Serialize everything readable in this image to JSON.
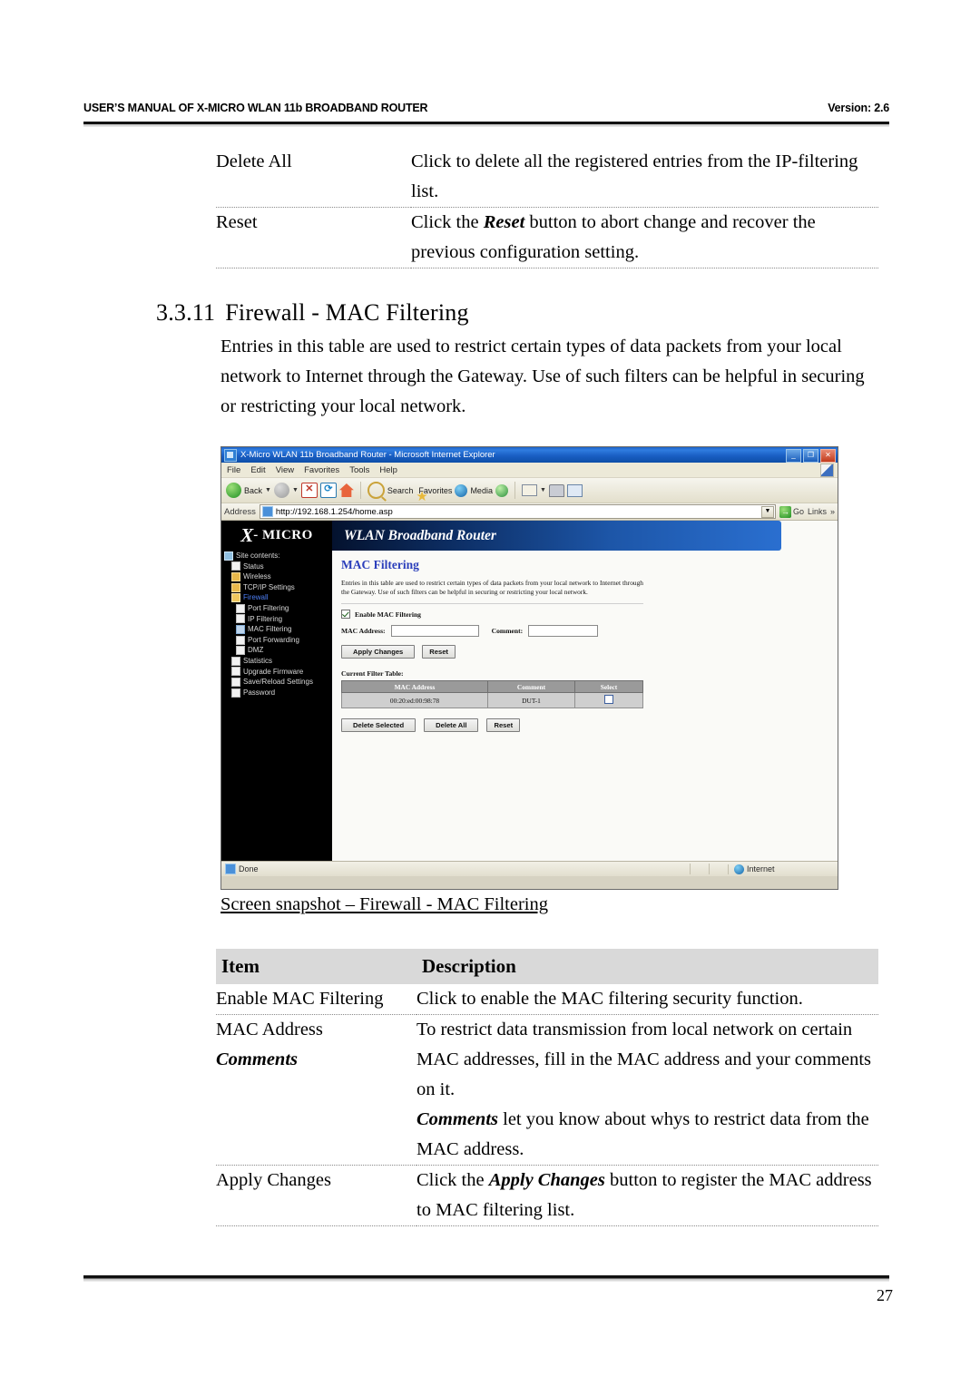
{
  "doc": {
    "header_left": "USER’S MANUAL OF X-MICRO WLAN 11b BROADBAND ROUTER",
    "header_right": "Version: 2.6",
    "page_number": "27"
  },
  "top_table": {
    "rows": [
      {
        "item": "Delete All",
        "desc": "Click to delete all the registered entries from the IP-filtering list."
      },
      {
        "item": "Reset",
        "desc_pre": "Click the ",
        "desc_em": "Reset",
        "desc_post": " button to abort change and recover the previous configuration setting."
      }
    ]
  },
  "section": {
    "number": "3.3.11",
    "title": "Firewall - MAC Filtering",
    "body": "Entries in this table are used to restrict certain types of data packets from your local network to Internet through the Gateway. Use of such filters can be helpful in securing or restricting your local network."
  },
  "browser": {
    "window_title": "X-Micro WLAN 11b Broadband Router - Microsoft Internet Explorer",
    "window_buttons": {
      "minimize": "_",
      "restore": "❐",
      "close": "✕"
    },
    "menus": [
      "File",
      "Edit",
      "View",
      "Favorites",
      "Tools",
      "Help"
    ],
    "toolbar": {
      "back": "Back",
      "search": "Search",
      "favorites": "Favorites",
      "media": "Media"
    },
    "address": {
      "label": "Address",
      "url": "http://192.168.1.254/home.asp",
      "go": "Go",
      "links": "Links"
    },
    "status": {
      "left": "Done",
      "right": "Internet"
    }
  },
  "router": {
    "logo": {
      "x": "X",
      "micro": "- MICRO"
    },
    "banner": "WLAN Broadband Router",
    "tree": [
      {
        "label": "Site contents:",
        "icon": "book-icon",
        "level": 1
      },
      {
        "label": "Status",
        "icon": "page-icon",
        "level": 1
      },
      {
        "label": "Wireless",
        "icon": "folder-icon",
        "level": 1
      },
      {
        "label": "TCP/IP Settings",
        "icon": "folder-icon",
        "level": 1
      },
      {
        "label": "Firewall",
        "icon": "folder-open-icon",
        "level": 1,
        "selected": true
      },
      {
        "label": "Port Filtering",
        "icon": "page-icon",
        "level": 2
      },
      {
        "label": "IP Filtering",
        "icon": "page-icon",
        "level": 2
      },
      {
        "label": "MAC Filtering",
        "icon": "page-selected-icon",
        "level": 2
      },
      {
        "label": "Port Forwarding",
        "icon": "page-icon",
        "level": 2
      },
      {
        "label": "DMZ",
        "icon": "page-icon",
        "level": 2
      },
      {
        "label": "Statistics",
        "icon": "page-icon",
        "level": 1
      },
      {
        "label": "Upgrade Firmware",
        "icon": "page-icon",
        "level": 1
      },
      {
        "label": "Save/Reload Settings",
        "icon": "page-icon",
        "level": 1
      },
      {
        "label": "Password",
        "icon": "page-icon",
        "level": 1
      }
    ],
    "page": {
      "title": "MAC Filtering",
      "description": "Entries in this table are used to restrict certain types of data packets from your local network to Internet through the Gateway. Use of such filters can be helpful in securing or restricting your local network.",
      "enable_label": "Enable MAC Filtering",
      "enable_checked": true,
      "mac_label": "MAC Address:",
      "mac_value": "",
      "comment_label": "Comment:",
      "comment_value": "",
      "apply_button": "Apply Changes",
      "reset_button": "Reset",
      "table_caption": "Current Filter Table:",
      "table_headers": [
        "MAC Address",
        "Comment",
        "Select"
      ],
      "table_rows": [
        {
          "mac": "00:20:ed:00:98:78",
          "comment": "DUT-1",
          "selected": false
        }
      ],
      "delete_selected_button": "Delete Selected",
      "delete_all_button": "Delete All",
      "table_reset_button": "Reset"
    }
  },
  "caption": "Screen snapshot – Firewall - MAC Filtering",
  "bottom_table": {
    "headers": [
      "Item",
      "Description"
    ],
    "rows": [
      {
        "item": "Enable MAC Filtering",
        "lines": [
          {
            "text": "Click to enable the MAC filtering security function."
          }
        ]
      },
      {
        "item": "MAC Address",
        "item_em": "Comments",
        "lines": [
          {
            "text": "To restrict data transmission from local network on certain MAC addresses, fill in the MAC address and your comments on it."
          },
          {
            "em": "Comments",
            "post": " let you know about whys to restrict data from the MAC address."
          }
        ]
      },
      {
        "item": "Apply Changes",
        "lines": [
          {
            "pre": "Click the ",
            "em": "Apply Changes",
            "post": " button to register the MAC address to MAC filtering list."
          }
        ]
      }
    ]
  }
}
